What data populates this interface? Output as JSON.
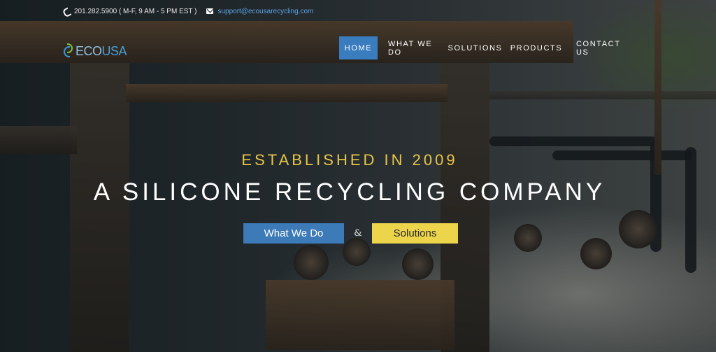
{
  "topbar": {
    "phone": "201.282.5900 ( M-F, 9 AM - 5 PM EST )",
    "email": "support@ecousarecycling.com",
    "phone_icon": "phone-icon",
    "email_icon": "envelope-icon"
  },
  "brand": {
    "eco": "ECO",
    "usa": "USA",
    "logo_icon": "leaf-logo-icon"
  },
  "nav": {
    "items": [
      {
        "label": "HOME",
        "active": true
      },
      {
        "label": "WHAT WE DO",
        "active": false
      },
      {
        "label": "SOLUTIONS",
        "active": false
      },
      {
        "label": "PRODUCTS",
        "active": false
      },
      {
        "label": "CONTACT US",
        "active": false
      }
    ]
  },
  "hero": {
    "established": "ESTABLISHED IN 2009",
    "headline": "A SILICONE RECYCLING COMPANY",
    "cta_primary": "What We Do",
    "separator": "&",
    "cta_secondary": "Solutions"
  },
  "colors": {
    "accent_blue": "#3a7dbf",
    "accent_yellow": "#ecd54a",
    "established_gold": "#e8c547",
    "email_link": "#5ba4e6"
  }
}
